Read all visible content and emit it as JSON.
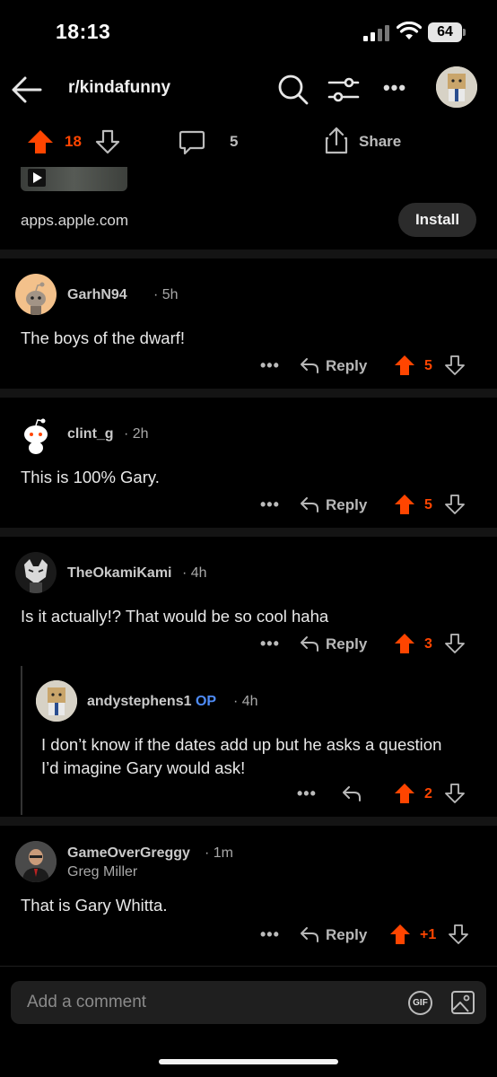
{
  "status": {
    "time": "18:13",
    "battery": "64"
  },
  "header": {
    "subreddit": "r/kindafunny"
  },
  "post_actions": {
    "upvotes": "18",
    "comments": "5",
    "share_label": "Share"
  },
  "ad": {
    "domain": "apps.apple.com",
    "install_label": "Install"
  },
  "comments": [
    {
      "author": "GarhN94",
      "time": "5h",
      "body": "The boys of the dwarf!",
      "votes": "5",
      "reply_label": "Reply"
    },
    {
      "author": "clint_g",
      "time": "2h",
      "body": "This is 100% Gary.",
      "votes": "5",
      "reply_label": "Reply"
    },
    {
      "author": "TheOkamiKami",
      "time": "4h",
      "body": "Is it actually!? That would be so cool haha",
      "votes": "3",
      "reply_label": "Reply"
    },
    {
      "author": "andystephens1",
      "op_tag": "OP",
      "time": "4h",
      "body": "I don’t know if the dates add up but he asks a question I’d imagine Gary would ask!",
      "votes": "2"
    },
    {
      "author": "GameOverGreggy",
      "flair": "Greg Miller",
      "time": "1m",
      "body": "That is Gary Whitta.",
      "votes": "+1",
      "reply_label": "Reply"
    }
  ],
  "compose": {
    "placeholder": "Add a comment",
    "gif_label": "GIF"
  },
  "colors": {
    "upvote": "#ff4500",
    "op": "#4f8cf7",
    "background": "#000000"
  }
}
